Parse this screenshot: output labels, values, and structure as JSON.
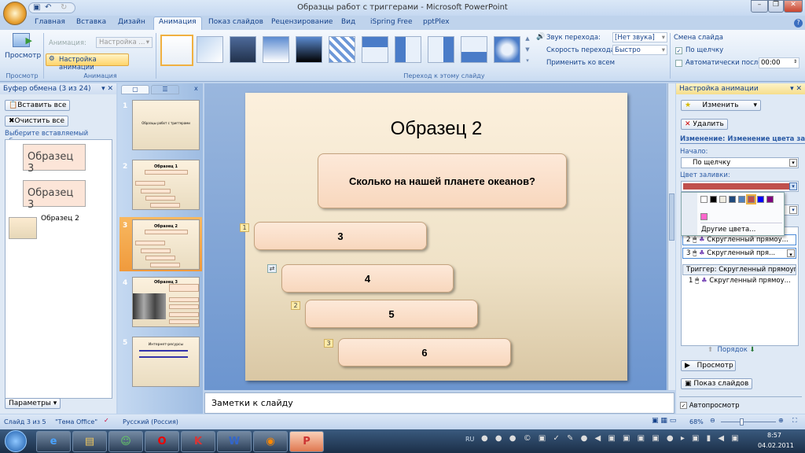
{
  "window": {
    "title": "Образцы работ с триггерами - Microsoft PowerPoint"
  },
  "tabs": [
    "Главная",
    "Вставка",
    "Дизайн",
    "Анимация",
    "Показ слайдов",
    "Рецензирование",
    "Вид",
    "iSpring Free",
    "pptPlex"
  ],
  "active_tab": "Анимация",
  "ribbon": {
    "preview_label": "Просмотр",
    "preview_group": "Просмотр",
    "animation_label": "Анимация:",
    "animation_value": "Настройка ...",
    "custom_animation": "Настройка анимации",
    "animation_group": "Анимация",
    "transition_group": "Переход к этому слайду",
    "sound_label": "Звук перехода:",
    "sound_value": "[Нет звука]",
    "speed_label": "Скорость перехода:",
    "speed_value": "Быстро",
    "apply_all": "Применить ко всем",
    "advance_title": "Смена слайда",
    "on_click": "По щелчку",
    "auto_after": "Автоматически после:",
    "auto_time": "00:00"
  },
  "clipboard": {
    "title": "Буфер обмена (3 из 24)",
    "paste_all": "Вставить все",
    "clear_all": "Очистить все",
    "prompt": "Выберите вставляемый объект:",
    "items": [
      "Образец 3",
      "Образец 3",
      "Образец 2"
    ],
    "options": "Параметры"
  },
  "thumbnails": {
    "numbers": [
      "1",
      "2",
      "3",
      "4",
      "5"
    ],
    "slide1_title": "Образцы работ с триггерами",
    "slide2_title": "Образец 1",
    "slide3_title": "Образец 2",
    "slide4_title": "Образец 3",
    "slide5_title": "Интернет-ресурсы"
  },
  "slide": {
    "title": "Образец 2",
    "question": "Сколько на нашей планете океанов?",
    "answers": [
      "3",
      "4",
      "5",
      "6"
    ],
    "tags": [
      "1",
      "2",
      "3"
    ]
  },
  "notes_placeholder": "Заметки к слайду",
  "custom_animation_pane": {
    "title": "Настройка анимации",
    "change": "Изменить",
    "remove": "Удалить",
    "effect_heading": "Изменение: Изменение цвета заливки",
    "start_label": "Начало:",
    "start_value": "По щелчку",
    "fill_label": "Цвет заливки:",
    "fill_color": "#c0504d",
    "palette": [
      "#ffffff",
      "#000000",
      "#eeece1",
      "#1f497d",
      "#4f81bd",
      "#c0504d",
      "#0000ff",
      "#800080",
      "#ff66cc"
    ],
    "more_colors": "Другие цвета...",
    "list": [
      {
        "n": "2",
        "label": "Скругленный прямоу..."
      },
      {
        "n": "3",
        "label": "Скругленный пря..."
      }
    ],
    "trigger_header": "Триггер: Скругленный прямоугол...",
    "trigger_items": [
      {
        "n": "1",
        "label": "Скругленный прямоу..."
      }
    ],
    "order": "Порядок",
    "play": "Просмотр",
    "slideshow": "Показ слайдов",
    "autopreview": "Автопросмотр"
  },
  "status": {
    "slide": "Слайд 3 из 5",
    "theme": "\"Тема Office\"",
    "language": "Русский (Россия)",
    "zoom": "68%"
  },
  "taskbar": {
    "lang": "RU",
    "time": "8:57",
    "date": "04.02.2011"
  }
}
